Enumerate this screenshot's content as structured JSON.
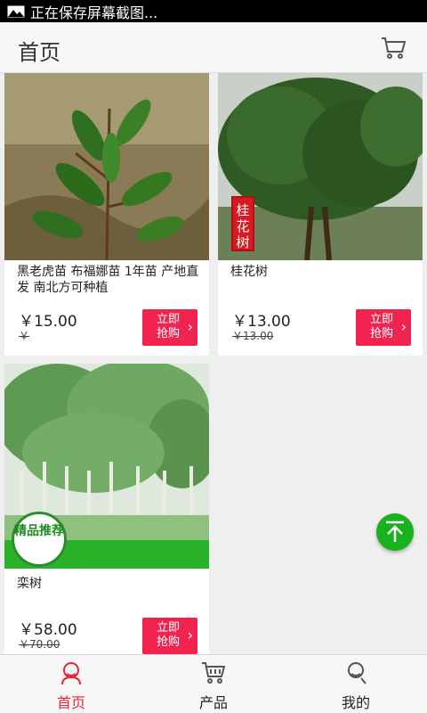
{
  "statusbar": {
    "text": "正在保存屏幕截图..."
  },
  "header": {
    "title": "首页",
    "cart_icon": "cart-icon"
  },
  "products": [
    {
      "name": "黑老虎苗 布福娜苗 1年苗 产地直发 南北方可种植",
      "price": "￥15.00",
      "old_price": "￥",
      "buy_label": "立即抢购",
      "arrow": "›"
    },
    {
      "name": "桂花树",
      "price": "￥13.00",
      "old_price": "￥13.00",
      "buy_label": "立即抢购",
      "arrow": "›",
      "badge": "桂花树"
    },
    {
      "name": "栾树",
      "price": "￥58.00",
      "old_price": "￥70.00",
      "buy_label": "立即抢购",
      "arrow": "›",
      "badge": "精品推荐"
    }
  ],
  "tabbar": {
    "items": [
      {
        "label": "首页",
        "icon": "home-icon",
        "active": true
      },
      {
        "label": "产品",
        "icon": "cart-icon",
        "active": false
      },
      {
        "label": "我的",
        "icon": "user-icon",
        "active": false
      }
    ]
  },
  "colors": {
    "accent": "#f0244f",
    "active_tab": "#e8253d",
    "fab": "#19b11e"
  }
}
